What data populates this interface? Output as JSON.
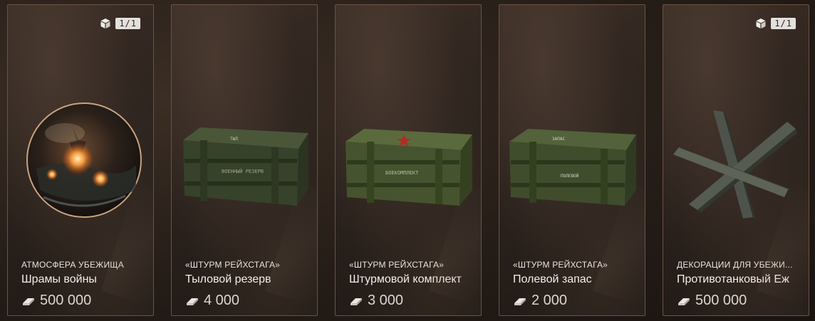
{
  "cards": [
    {
      "category": "АТМОСФЕРА УБЕЖИЩА",
      "name": "Шрамы войны",
      "price": "500 000",
      "badge": "1/1",
      "art": "globe"
    },
    {
      "category": "«ШТУРМ РЕЙХСТАГА»",
      "name": "Тыловой резерв",
      "price": "4 000",
      "art": "crate"
    },
    {
      "category": "«ШТУРМ РЕЙХСТАГА»",
      "name": "Штурмовой комплект",
      "price": "3 000",
      "art": "crate"
    },
    {
      "category": "«ШТУРМ РЕЙХСТАГА»",
      "name": "Полевой запас",
      "price": "2 000",
      "art": "crate"
    },
    {
      "category": "ДЕКОРАЦИИ ДЛЯ УБЕЖИ...",
      "name": "Противотанковый Еж",
      "price": "500 000",
      "badge": "1/1",
      "art": "hedgehog"
    }
  ],
  "icons": {
    "badge": "box-icon",
    "price": "ingot-icon"
  },
  "colors": {
    "card_border": "#6b5244",
    "crate_green": "#3c4a2e",
    "text": "#f1eee9"
  }
}
